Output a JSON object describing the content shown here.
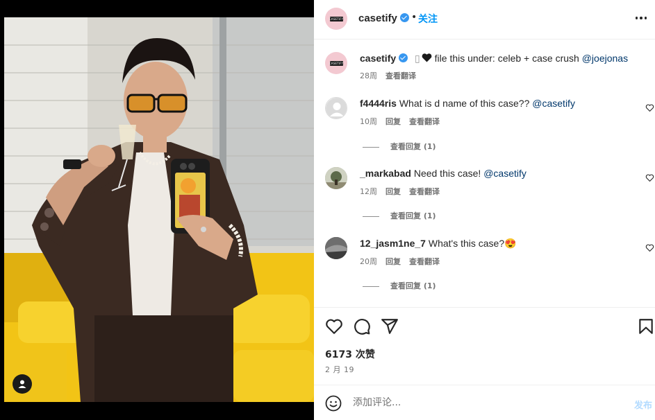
{
  "post_author": {
    "username": "casetify",
    "verified": true,
    "follow_label": "关注",
    "separator": "•",
    "avatar_logo_text": "CASETiFY"
  },
  "caption": {
    "username": "casetify",
    "emoji_mark": "▯",
    "text": " file this under: celeb + case crush ",
    "mention": "@joejonas",
    "time": "28周",
    "translate_label": "查看翻译"
  },
  "comments": [
    {
      "username": "f4444ris",
      "text": " What is d name of this case?? ",
      "mention": "@casetify",
      "time": "10周",
      "reply_label": "回复",
      "translate_label": "查看翻译",
      "view_replies": "查看回复 (1)"
    },
    {
      "username": "_markabad",
      "text": " Need this case! ",
      "mention": "@casetify",
      "time": "12周",
      "reply_label": "回复",
      "translate_label": "查看翻译",
      "view_replies": "查看回复 (1)"
    },
    {
      "username": "12_jasm1ne_7",
      "text": " What's this case?",
      "emoji": "😍",
      "time": "20周",
      "reply_label": "回复",
      "translate_label": "查看翻译",
      "view_replies": "查看回复 (1)"
    }
  ],
  "actions": {
    "likes": "6173 次赞",
    "date": "2 月 19",
    "icons": [
      "heart-icon",
      "comment-icon",
      "share-icon",
      "bookmark-icon"
    ]
  },
  "add_comment": {
    "placeholder": "添加评论...",
    "post_label": "发布"
  },
  "colors": {
    "accent": "#0095f6",
    "verified": "#3797f0",
    "mention": "#00376b",
    "post_disabled": "#b3dbff",
    "meta": "#737373"
  }
}
